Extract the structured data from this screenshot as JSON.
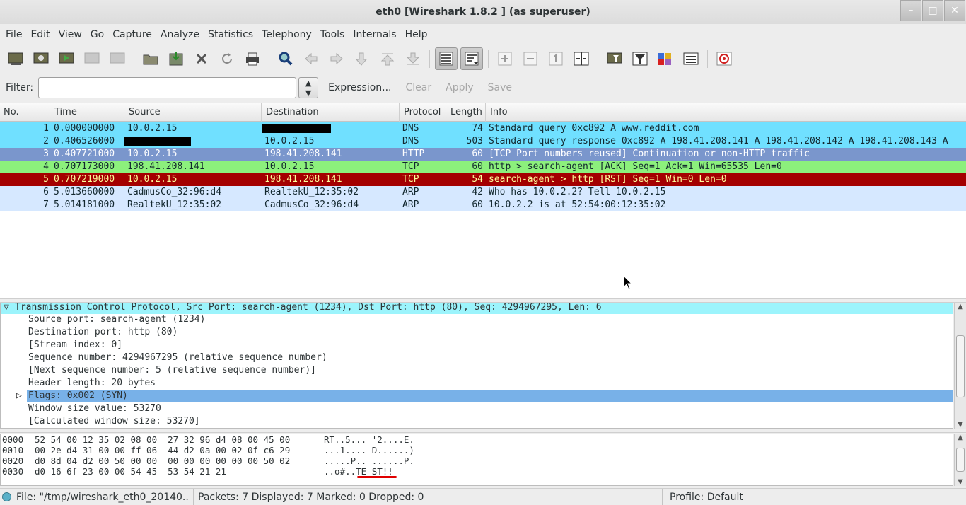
{
  "window": {
    "title": "eth0   [Wireshark 1.8.2 ] (as superuser)",
    "controls": [
      "–",
      "□",
      "✕"
    ]
  },
  "menu": [
    "File",
    "Edit",
    "View",
    "Go",
    "Capture",
    "Analyze",
    "Statistics",
    "Telephony",
    "Tools",
    "Internals",
    "Help"
  ],
  "toolbar": {
    "icons": [
      "interfaces-icon",
      "options-icon",
      "start-capture-icon",
      "stop-capture-icon",
      "restart-capture-icon",
      "open-icon",
      "save-icon",
      "close-icon",
      "reload-icon",
      "print-icon",
      "find-icon",
      "back-icon",
      "forward-icon",
      "go-to-packet-icon",
      "first-packet-icon",
      "last-packet-icon",
      "colorize-icon",
      "auto-scroll-icon",
      "zoom-in-icon",
      "zoom-out-icon",
      "normal-size-icon",
      "resize-columns-icon",
      "capture-filters-icon",
      "display-filters-icon",
      "coloring-rules-icon",
      "preferences-icon",
      "help-icon"
    ]
  },
  "filter": {
    "label": "Filter:",
    "value": "",
    "expression": "Expression...",
    "clear": "Clear",
    "apply": "Apply",
    "save": "Save"
  },
  "packet_list": {
    "columns": [
      "No.",
      "Time",
      "Source",
      "Destination",
      "Protocol",
      "Length",
      "Info"
    ],
    "rows": [
      {
        "no": "1",
        "time": "0.000000000",
        "source": "10.0.2.15",
        "destination": "",
        "protocol": "DNS",
        "length": "74",
        "info": "Standard query 0xc892  A www.reddit.com",
        "bg": "#70e0ff",
        "fg": "#12272e",
        "redact_dst": true
      },
      {
        "no": "2",
        "time": "0.406526000",
        "source": "",
        "destination": "10.0.2.15",
        "protocol": "DNS",
        "length": "503",
        "info": "Standard query response 0xc892  A 198.41.208.141 A 198.41.208.142 A 198.41.208.143 A",
        "bg": "#70e0ff",
        "fg": "#12272e",
        "redact_src": true
      },
      {
        "no": "3",
        "time": "0.407721000",
        "source": "10.0.2.15",
        "destination": "198.41.208.141",
        "protocol": "HTTP",
        "length": "60",
        "info": "[TCP Port numbers reused] Continuation or non-HTTP traffic",
        "bg": "#7a96cc",
        "fg": "#ffffff"
      },
      {
        "no": "4",
        "time": "0.707173000",
        "source": "198.41.208.141",
        "destination": "10.0.2.15",
        "protocol": "TCP",
        "length": "60",
        "info": "http > search-agent [ACK] Seq=1 Ack=1 Win=65535 Len=0",
        "bg": "#8cf07c",
        "fg": "#12272e"
      },
      {
        "no": "5",
        "time": "0.707219000",
        "source": "10.0.2.15",
        "destination": "198.41.208.141",
        "protocol": "TCP",
        "length": "54",
        "info": "search-agent > http [RST] Seq=1 Win=0 Len=0",
        "bg": "#a40000",
        "fg": "#fffc9c"
      },
      {
        "no": "6",
        "time": "5.013660000",
        "source": "CadmusCo_32:96:d4",
        "destination": "RealtekU_12:35:02",
        "protocol": "ARP",
        "length": "42",
        "info": "Who has 10.0.2.2?  Tell 10.0.2.15",
        "bg": "#d6e8ff",
        "fg": "#12272e"
      },
      {
        "no": "7",
        "time": "5.014181000",
        "source": "RealtekU_12:35:02",
        "destination": "CadmusCo_32:96:d4",
        "protocol": "ARP",
        "length": "60",
        "info": "10.0.2.2 is at 52:54:00:12:35:02",
        "bg": "#d6e8ff",
        "fg": "#12272e"
      }
    ]
  },
  "details": {
    "header": "Transmission Control Protocol, Src Port: search-agent (1234), Dst Port: http (80), Seq: 4294967295, Len: 6",
    "lines": [
      "Source port: search-agent (1234)",
      "Destination port: http (80)",
      "[Stream index: 0]",
      "Sequence number: 4294967295    (relative sequence number)",
      "[Next sequence number: 5    (relative sequence number)]",
      "Header length: 20 bytes",
      "Flags: 0x002 (SYN)",
      "Window size value: 53270",
      "[Calculated window size: 53270]"
    ]
  },
  "hex": [
    {
      "offset": "0000",
      "bytes": "52 54 00 12 35 02 08 00  27 32 96 d4 08 00 45 00",
      "ascii": "RT..5... '2....E."
    },
    {
      "offset": "0010",
      "bytes": "00 2e d4 31 00 00 ff 06  44 d2 0a 00 02 0f c6 29",
      "ascii": "...1.... D......)"
    },
    {
      "offset": "0020",
      "bytes": "d0 8d 04 d2 00 50 00 00  00 00 00 00 00 00 50 02",
      "ascii": ".....P.. ......P."
    },
    {
      "offset": "0030",
      "bytes": "d0 16 6f 23 00 00 54 45  53 54 21 21",
      "ascii": "..o#..TE ST!!"
    }
  ],
  "status": {
    "file": "File: \"/tmp/wireshark_eth0_20140...",
    "packets": "Packets: 7 Displayed: 7 Marked: 0 Dropped: 0",
    "profile": "Profile: Default"
  },
  "colors": {
    "selected": "#78b1e8",
    "tcp_header": "#9cf4fc",
    "underline": "#e00000"
  }
}
